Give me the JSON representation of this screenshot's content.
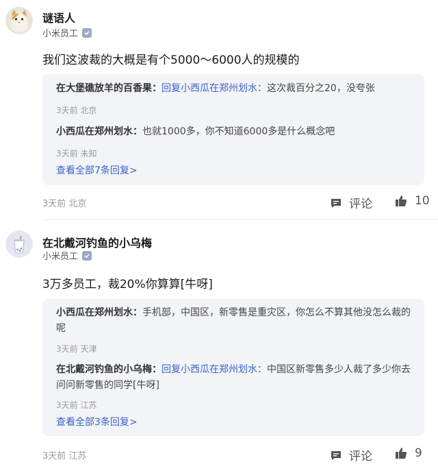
{
  "comments": [
    {
      "username": "谜语人",
      "role": "小米员工",
      "text": "我们这波裁的大概是有个5000～6000人的规模的",
      "replies": [
        {
          "name": "在大堡礁放羊的百香果：",
          "reply_to": "回复小西瓜在郑州划水：",
          "text": "这次裁百分之20，没夸张",
          "meta": "3天前 北京"
        },
        {
          "name": "小西瓜在郑州划水：",
          "reply_to": "",
          "text": "也就1000多，你不知道6000多是什么概念吧",
          "meta": "3天前 未知"
        }
      ],
      "view_all": "查看全部7条回复>",
      "meta": "3天前 北京",
      "comment_label": "评论",
      "likes": "10"
    },
    {
      "username": "在北戴河钓鱼的小乌梅",
      "role": "小米员工",
      "text": "3万多员工，裁20%你算算[牛呀]",
      "replies": [
        {
          "name": "小西瓜在郑州划水：",
          "reply_to": "",
          "text": "手机部，中国区，新零售是重灾区，你怎么不算其他没怎么裁的呢",
          "meta": "3天前 天津"
        },
        {
          "name": "在北戴河钓鱼的小乌梅：",
          "reply_to": "回复小西瓜在郑州划水：",
          "text": "中国区新零售多少人裁了多少你去问问新零售的同学[牛呀]",
          "meta": "3天前 江苏"
        }
      ],
      "view_all": "查看全部3条回复>",
      "meta": "3天前 江苏",
      "comment_label": "评论",
      "likes": "9"
    }
  ],
  "colors": {
    "link": "#3a62c9",
    "reply_bg": "#f3f4f7",
    "meta": "#999999"
  },
  "icons": [
    "cat-avatar",
    "tea-cup-avatar",
    "verified-icon",
    "comment-icon",
    "thumbs-up-icon"
  ]
}
